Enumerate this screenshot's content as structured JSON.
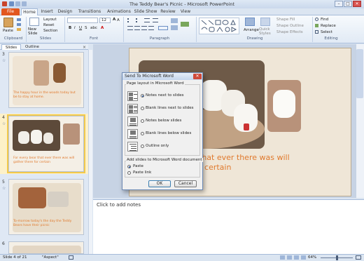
{
  "window": {
    "title": "The Teddy Bear's Picnic - Microsoft PowerPoint",
    "min_glyph": "–",
    "max_glyph": "□",
    "close_glyph": "✕"
  },
  "ribbon_tabs": [
    "File",
    "Home",
    "Insert",
    "Design",
    "Transitions",
    "Animations",
    "Slide Show",
    "Review",
    "View"
  ],
  "ribbon": {
    "paste": "Paste",
    "new_slide": "New Slide",
    "layout": "Layout",
    "reset": "Reset",
    "section": "Section",
    "font_size": "12",
    "arrange": "Arrange",
    "quick_styles": "Quick Styles",
    "shape_fill": "Shape Fill",
    "shape_outline": "Shape Outline",
    "shape_effects": "Shape Effects",
    "find": "Find",
    "replace": "Replace",
    "select": "Select",
    "groups": {
      "clipboard": "Clipboard",
      "slides": "Slides",
      "font": "Font",
      "paragraph": "Paragraph",
      "drawing": "Drawing",
      "editing": "Editing"
    }
  },
  "panel": {
    "tabs": [
      "Slides",
      "Outline"
    ],
    "close": "×"
  },
  "thumbnails": [
    {
      "num": "3",
      "text": "The happy hour in the woods today but be to stay at home.",
      "star": "☆"
    },
    {
      "num": "4",
      "text": "For every bear that ever there was will gather there for certain",
      "star": "☆"
    },
    {
      "num": "5",
      "text": "To-morrow today's the day the Teddy Bears have their picnic",
      "star": "☆"
    },
    {
      "num": "6",
      "text": "",
      "star": ""
    }
  ],
  "slide": {
    "text_line1": "that ever there was will",
    "text_line2": "r certain"
  },
  "notes": {
    "placeholder": "Click to add notes"
  },
  "status": {
    "slide_info": "Slide 4 of 21",
    "theme": "\"Aspect\"",
    "zoom": "64%"
  },
  "dialog": {
    "title": "Send To Microsoft Word",
    "close": "✕",
    "section_layout": "Page layout in Microsoft Word",
    "options": [
      {
        "label": "Notes next to slides",
        "selected": true
      },
      {
        "label": "Blank lines next to slides",
        "selected": false
      },
      {
        "label": "Notes below slides",
        "selected": false
      },
      {
        "label": "Blank lines below slides",
        "selected": false
      },
      {
        "label": "Outline only",
        "selected": false
      }
    ],
    "section_add": "Add slides to Microsoft Word document",
    "paste_options": [
      {
        "label": "Paste",
        "selected": true
      },
      {
        "label": "Paste link",
        "selected": false
      }
    ],
    "ok": "OK",
    "cancel": "Cancel"
  },
  "colors": {
    "accent": "#e2571e",
    "slide_text": "#e07a2e",
    "ribbon_bg": "#f7fafd"
  }
}
